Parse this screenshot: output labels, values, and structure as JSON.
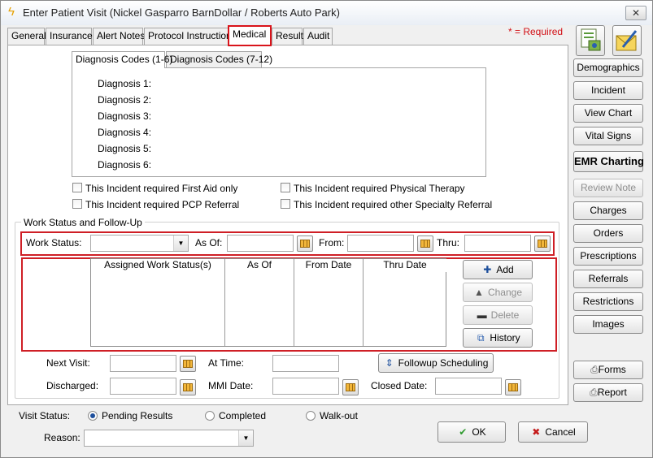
{
  "window": {
    "title": "Enter Patient Visit (Nickel Gasparro BarnDollar / Roberts Auto Park)",
    "close_symbol": "✕",
    "app_icon": "lightning-icon"
  },
  "tabs": [
    "General",
    "Insurance",
    "Alert Notes",
    "Protocol Instructions",
    "Medical",
    "Results",
    "Audit"
  ],
  "active_tab": "Medical",
  "required_note": "* = Required",
  "diagnosis": {
    "tabs": [
      "Diagnosis Codes (1-6)",
      "Diagnosis Codes (7-12)"
    ],
    "labels": [
      "Diagnosis 1:",
      "Diagnosis 2:",
      "Diagnosis 3:",
      "Diagnosis 4:",
      "Diagnosis 5:",
      "Diagnosis 6:"
    ]
  },
  "checkboxes": {
    "first_aid": "This Incident required First Aid only",
    "physical_therapy": "This Incident required Physical Therapy",
    "pcp_referral": "This Incident required PCP Referral",
    "specialty_referral": "This Incident required other Specialty Referral"
  },
  "work_status": {
    "group_title": "Work Status and Follow-Up",
    "work_status_label": "Work Status:",
    "as_of_label": "As Of:",
    "from_label": "From:",
    "thru_label": "Thru:",
    "grid_headers": [
      "Assigned Work Status(s)",
      "As Of",
      "From Date",
      "Thru Date"
    ],
    "buttons": {
      "add": "Add",
      "change": "Change",
      "delete": "Delete",
      "history": "History"
    }
  },
  "followup": {
    "next_visit_label": "Next Visit:",
    "at_time_label": "At Time:",
    "followup_button": "Followup Scheduling",
    "discharged_label": "Discharged:",
    "mmi_date_label": "MMI Date:",
    "closed_date_label": "Closed Date:"
  },
  "visit_status": {
    "label": "Visit Status:",
    "options": [
      "Pending Results",
      "Completed",
      "Walk-out"
    ],
    "selected": "Pending Results",
    "reason_label": "Reason:"
  },
  "sidebar": {
    "buttons": [
      "Demographics",
      "Incident",
      "View Chart",
      "Vital Signs",
      "EMR Charting",
      "Review Note",
      "Charges",
      "Orders",
      "Prescriptions",
      "Referrals",
      "Restrictions",
      "Images"
    ],
    "bottom_buttons": [
      "Forms",
      "Report"
    ]
  },
  "footer": {
    "ok": "OK",
    "cancel": "Cancel"
  },
  "colors": {
    "highlight_red": "#cf1f26",
    "required_red": "#d20f15",
    "add_icon_blue": "#1d4f9c",
    "cancel_icon_red": "#c41a1a",
    "ok_icon_green": "#2e9a2e"
  }
}
